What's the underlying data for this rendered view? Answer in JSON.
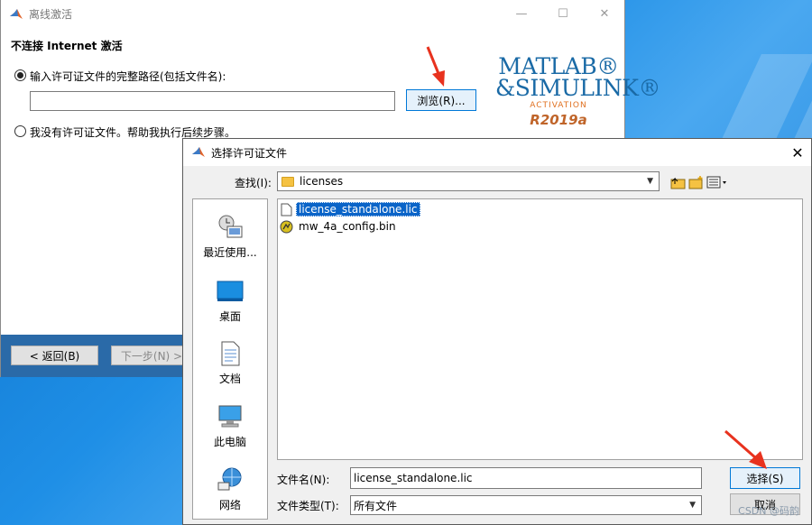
{
  "main_window": {
    "title": "离线激活",
    "heading": "不连接 Internet 激活",
    "option_path_label": "输入许可证文件的完整路径(包括文件名):",
    "option_help_label": "我没有许可证文件。帮助我执行后续步骤。",
    "path_value": "",
    "browse_button": "浏览(R)...",
    "back_button": "< 返回(B)",
    "next_button": "下一步(N) >",
    "brand": {
      "line1": "MATLAB®",
      "line2": "&SIMULINK®",
      "line3": "ACTIVATION",
      "version": "R2019a"
    }
  },
  "dialog": {
    "title": "选择许可证文件",
    "lookin_label": "查找(I):",
    "lookin_value": "licenses",
    "places": [
      "最近使用...",
      "桌面",
      "文档",
      "此电脑",
      "网络"
    ],
    "files": [
      {
        "name": "license_standalone.lic",
        "selected": true,
        "icon": "document-icon"
      },
      {
        "name": "mw_4a_config.bin",
        "selected": false,
        "icon": "matlab-file-icon"
      }
    ],
    "filename_label": "文件名(N):",
    "filename_value": "license_standalone.lic",
    "filetype_label": "文件类型(T):",
    "filetype_value": "所有文件",
    "select_button": "选择(S)",
    "cancel_button": "取消"
  },
  "watermark": "CSDN @码韵",
  "colors": {
    "accent": "#0078d7",
    "selection": "#0a64c8",
    "matlab_blue": "#1a6aa6",
    "arrow": "#e8321e"
  }
}
